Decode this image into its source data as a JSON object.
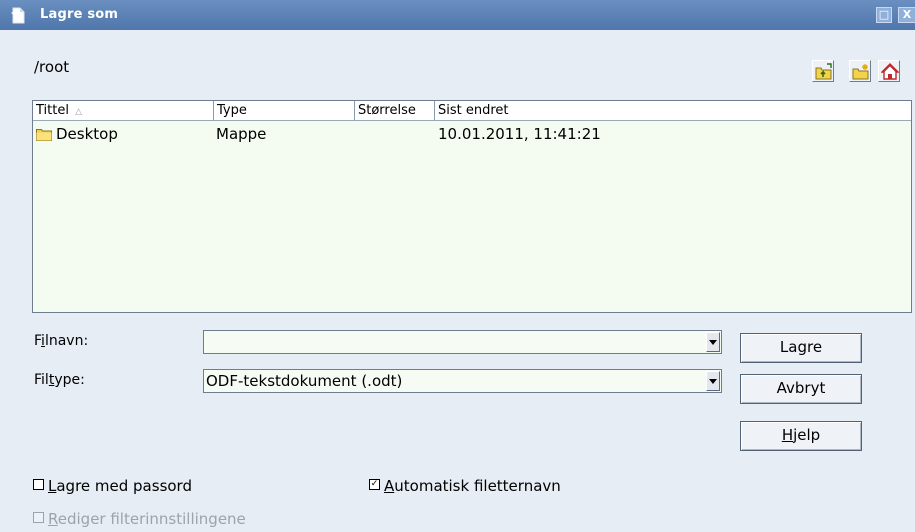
{
  "window": {
    "title": "Lagre som",
    "maximize_glyph": "□",
    "close_glyph": "X"
  },
  "path": "/root",
  "toolbar": {
    "buttons": [
      {
        "icon": "folder-up-icon"
      },
      {
        "icon": "new-folder-icon"
      },
      {
        "icon": "home-icon"
      }
    ]
  },
  "file_list": {
    "columns": [
      "Tittel",
      "Type",
      "Størrelse",
      "Sist endret"
    ],
    "sort_glyph": "△",
    "rows": [
      {
        "name": "Desktop",
        "type": "Mappe",
        "size": "",
        "modified": "10.01.2011, 11:41:21",
        "icon": "folder-icon"
      }
    ]
  },
  "form": {
    "filename_label_pre": "F",
    "filename_label_key": "i",
    "filename_label_post": "lnavn:",
    "filename_value": "",
    "filetype_label_pre": "Fil",
    "filetype_label_key": "t",
    "filetype_label_post": "ype:",
    "filetype_value": "ODF-tekstdokument (.odt)"
  },
  "buttons": {
    "save": "Lagre",
    "cancel": "Avbryt",
    "help_key": "H",
    "help_rest": "jelp"
  },
  "options": {
    "password_key": "L",
    "password_rest": "agre med passord",
    "password_checked": false,
    "auto_ext_key": "A",
    "auto_ext_rest": "utomatisk filetternavn",
    "auto_ext_checked": true,
    "auto_ext_mark": "✓",
    "filter_key": "R",
    "filter_rest": "ediger filterinnstillingene",
    "filter_checked": false
  },
  "colors": {
    "titlebar": "#5a80b5",
    "background": "#e7edf5",
    "list_background": "#f4fbf1",
    "folder": "#f3d34a"
  }
}
